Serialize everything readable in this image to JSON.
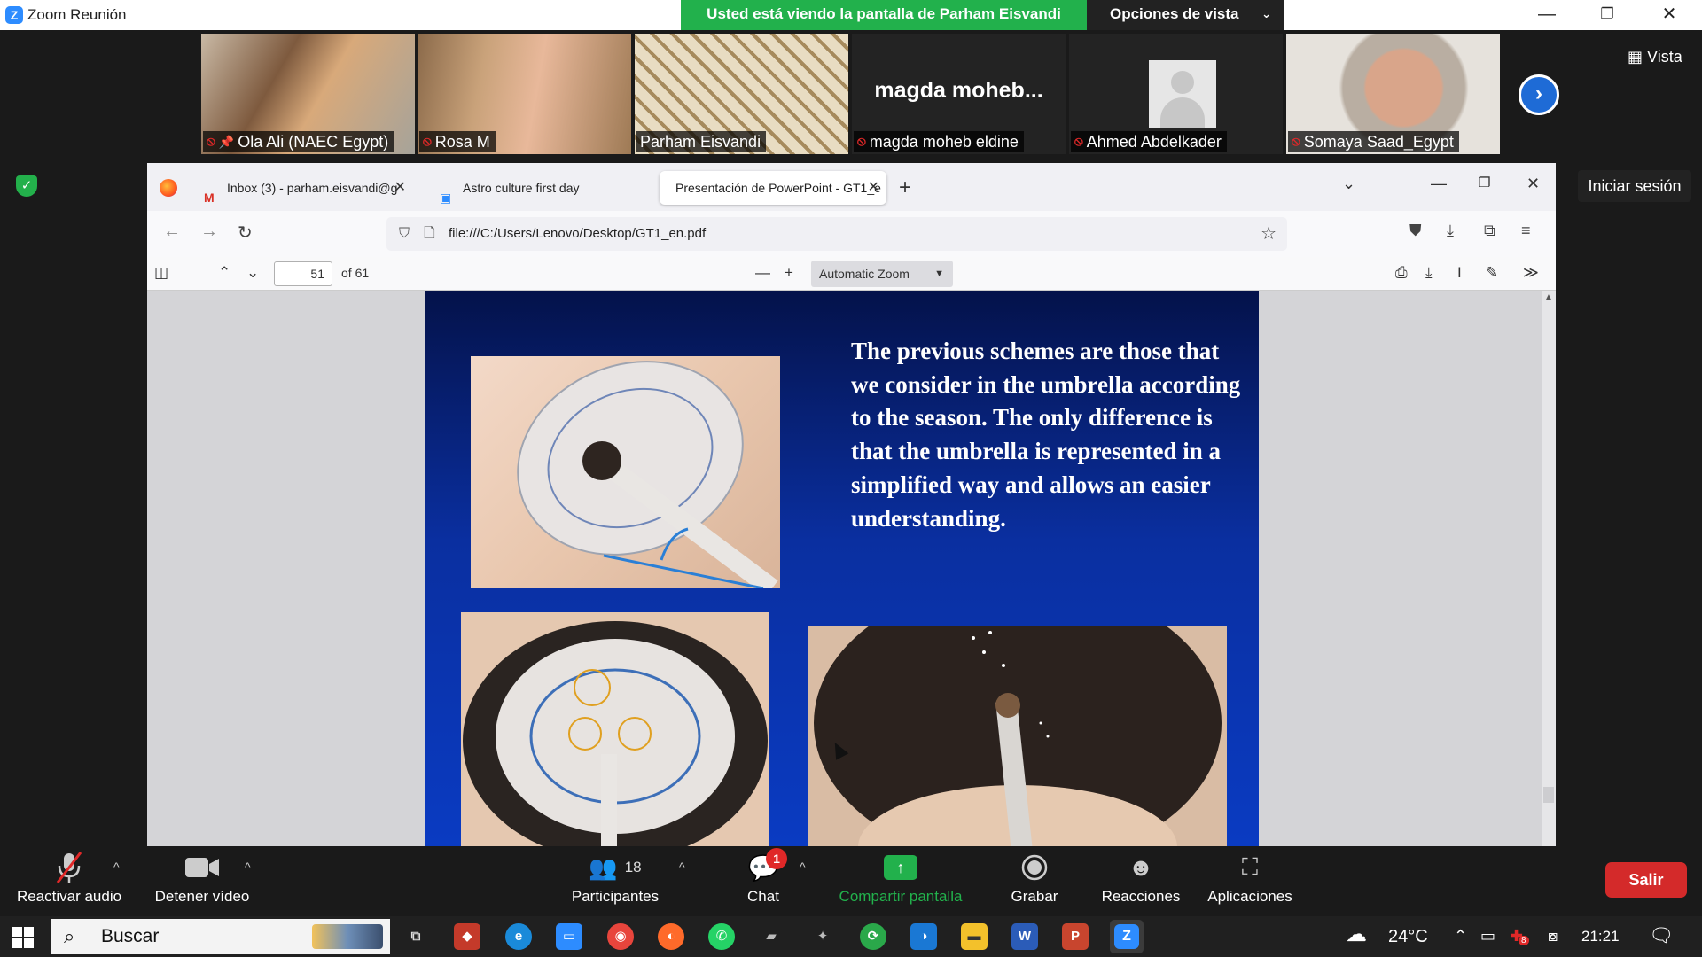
{
  "zoom": {
    "window_title": "Zoom Reunión",
    "sharing_banner": "Usted está viendo la pantalla de Parham Eisvandi",
    "view_options_label": "Opciones de vista",
    "view_label": "Vista",
    "sign_in_label": "Iniciar sesión",
    "participants": [
      {
        "name": "Ola Ali (NAEC Egypt)",
        "muted": true,
        "pinned": true,
        "video": true
      },
      {
        "name": "Rosa M",
        "muted": true,
        "video": true
      },
      {
        "name": "Parham Eisvandi",
        "muted": false,
        "video": true,
        "active": true
      },
      {
        "name": "magda moheb eldine",
        "display_name": "magda  moheb...",
        "muted": true,
        "video": false
      },
      {
        "name": "Ahmed Abdelkader",
        "muted": true,
        "video": false,
        "avatar": "placeholder"
      },
      {
        "name": "Somaya Saad_Egypt",
        "muted": true,
        "video": true
      }
    ]
  },
  "browser": {
    "tabs": [
      {
        "label": "Inbox (3) - parham.eisvandi@g",
        "icon": "gmail-icon"
      },
      {
        "label": "Astro culture first day",
        "icon": "zoom-icon"
      },
      {
        "label": "Presentación de PowerPoint - GT1_e",
        "selected": true
      }
    ],
    "url": "file:///C:/Users/Lenovo/Desktop/GT1_en.pdf",
    "pdf": {
      "page_number": "51",
      "page_total": "of 61",
      "zoom": "Automatic Zoom"
    },
    "slide_text": "The previous schemes are those that we consider in the umbrella according to the season. The only difference is that the umbrella is represented in a simplified way and allows an easier understanding."
  },
  "toolbar": {
    "unmute": "Reactivar audio",
    "stop_video": "Detener vídeo",
    "participants": "Participantes",
    "participants_count": "18",
    "chat": "Chat",
    "chat_badge": "1",
    "share_screen": "Compartir pantalla",
    "record": "Grabar",
    "reactions": "Reacciones",
    "apps": "Aplicaciones",
    "leave": "Salir"
  },
  "taskbar": {
    "search_label": "Buscar",
    "temperature": "24°C",
    "time": "21:21",
    "notification_badge": "8"
  },
  "colors": {
    "zoom_green": "#22b14c",
    "leave_red": "#d42a2a",
    "zoom_blue": "#2d8cff"
  }
}
